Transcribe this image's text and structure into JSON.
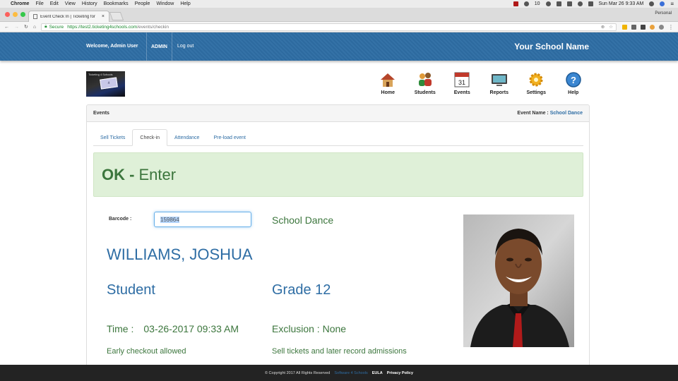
{
  "macmenu": {
    "app": "Chrome",
    "items": [
      "File",
      "Edit",
      "View",
      "History",
      "Bookmarks",
      "People",
      "Window",
      "Help"
    ],
    "battery_label": "10",
    "clock": "Sun Mar 26  9:33 AM"
  },
  "browser": {
    "tab_title": "Event Check In | Ticketing for",
    "profile": "Personal",
    "secure_label": "Secure",
    "url_host": "https://test2.ticketing4schools.com",
    "url_path": "/events/checkin"
  },
  "header": {
    "welcome": "Welcome, Admin User",
    "role": "ADMIN",
    "logout": "Log out",
    "school_name": "Your School Name"
  },
  "nav": {
    "items": [
      {
        "label": "Home",
        "icon": "home-icon"
      },
      {
        "label": "Students",
        "icon": "students-icon"
      },
      {
        "label": "Events",
        "icon": "calendar-icon"
      },
      {
        "label": "Reports",
        "icon": "monitor-icon"
      },
      {
        "label": "Settings",
        "icon": "gear-icon"
      },
      {
        "label": "Help",
        "icon": "help-icon"
      }
    ],
    "calendar_day": "31"
  },
  "panel": {
    "title": "Events",
    "event_name_label": "Event Name : ",
    "event_name": "School Dance"
  },
  "tabs": [
    {
      "label": "Sell Tickets",
      "active": false
    },
    {
      "label": "Check-in",
      "active": true
    },
    {
      "label": "Attendance",
      "active": false
    },
    {
      "label": "Pre-load event",
      "active": false
    }
  ],
  "status": {
    "ok": "OK -",
    "message": "Enter",
    "color": "#dff0d8"
  },
  "checkin": {
    "barcode_label": "Barcode :",
    "barcode_value": "159864",
    "event": "School Dance",
    "student_name": "WILLIAMS, JOSHUA",
    "type": "Student",
    "grade": "Grade 12",
    "time_label": "Time :",
    "time_value": "03-26-2017 09:33 AM",
    "exclusion": "Exclusion : None",
    "early_checkout": "Early checkout allowed",
    "sell_note": "Sell tickets and later record admissions"
  },
  "footer": {
    "copyright": "© Copyright 2017 All Rights Reserved",
    "company": "Software 4 Schools",
    "eula": "EULA",
    "privacy": "Privacy Policy"
  },
  "colors": {
    "brand": "#2e6da4",
    "success": "#3c763d"
  }
}
